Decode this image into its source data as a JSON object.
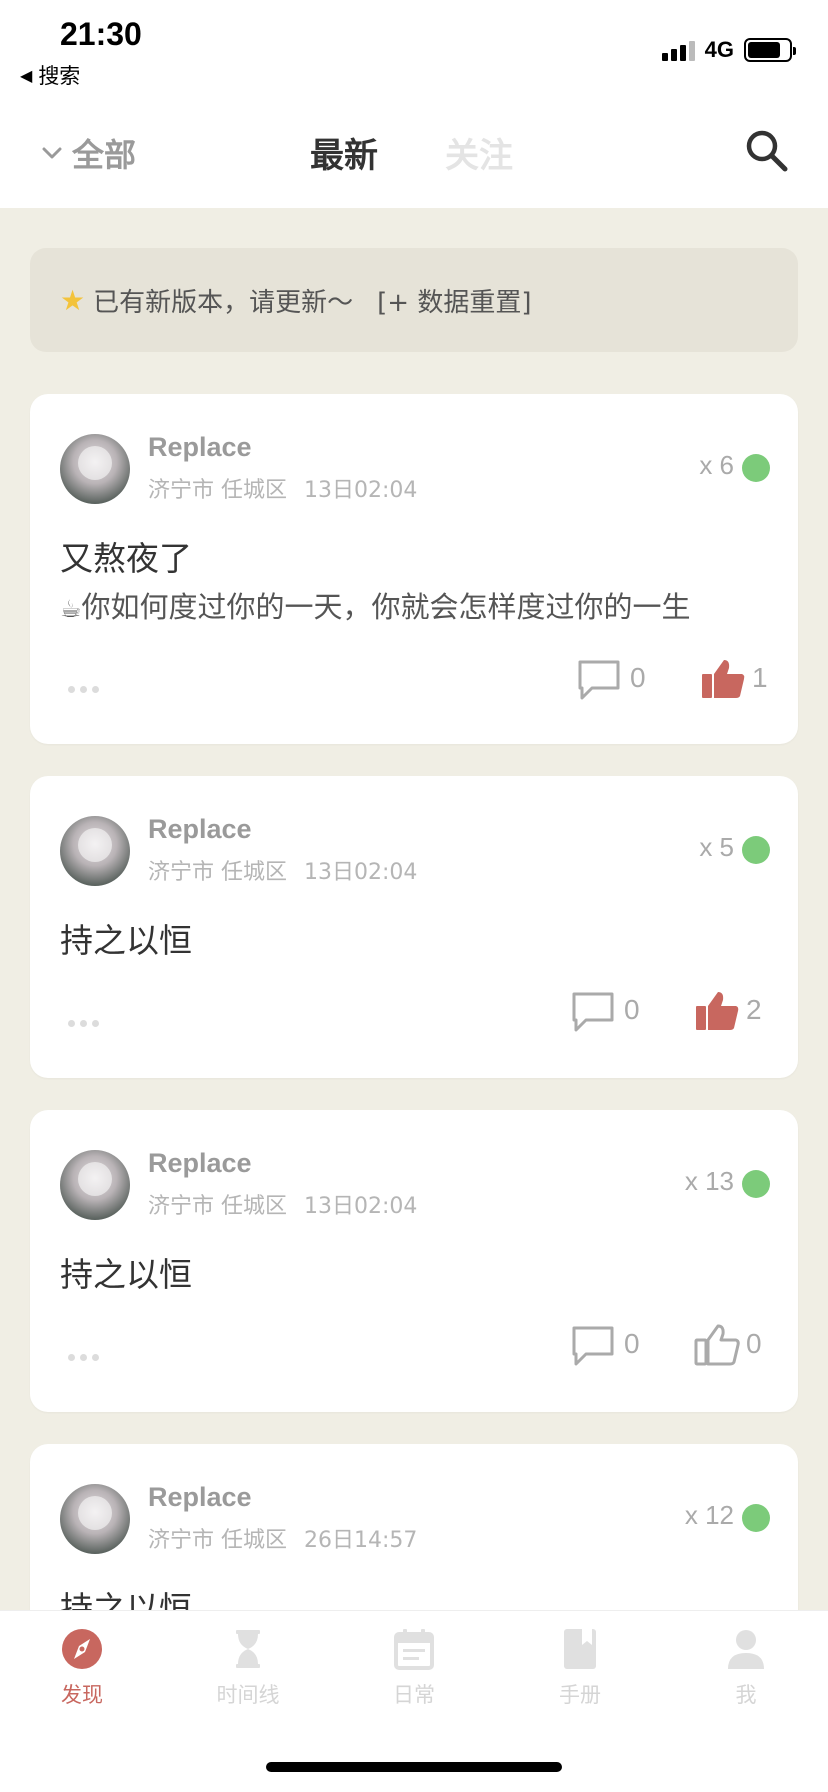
{
  "status_bar": {
    "time": "21:30",
    "back_label": "搜索",
    "network": "4G"
  },
  "nav": {
    "all_label": "全部",
    "tab_latest": "最新",
    "tab_follow": "关注"
  },
  "notice": {
    "text": "已有新版本，请更新～",
    "action": "[+ 数据重置]"
  },
  "posts": [
    {
      "author": "Replace",
      "location": "济宁市 任城区",
      "time": "13日02:04",
      "count": "x 6",
      "title": "又熬夜了",
      "body": "你如何度过你的一天，你就会怎样度过你的一生",
      "comments": "0",
      "likes": "1",
      "liked": true
    },
    {
      "author": "Replace",
      "location": "济宁市 任城区",
      "time": "13日02:04",
      "count": "x 5",
      "title": "持之以恒",
      "body": "",
      "comments": "0",
      "likes": "2",
      "liked": true
    },
    {
      "author": "Replace",
      "location": "济宁市 任城区",
      "time": "13日02:04",
      "count": "x 13",
      "title": "持之以恒",
      "body": "",
      "comments": "0",
      "likes": "0",
      "liked": false
    },
    {
      "author": "Replace",
      "location": "济宁市 任城区",
      "time": "26日14:57",
      "count": "x 12",
      "title": "持之以恒",
      "body": "",
      "comments": "",
      "likes": "",
      "liked": false
    }
  ],
  "tab_bar": [
    {
      "label": "发现",
      "icon": "compass-icon",
      "active": true
    },
    {
      "label": "时间线",
      "icon": "hourglass-icon",
      "active": false
    },
    {
      "label": "日常",
      "icon": "calendar-icon",
      "active": false
    },
    {
      "label": "手册",
      "icon": "book-icon",
      "active": false
    },
    {
      "label": "我",
      "icon": "person-icon",
      "active": false
    }
  ],
  "colors": {
    "accent": "#c8675f",
    "online_dot": "#7ccb7a",
    "background": "#f0eee4"
  }
}
